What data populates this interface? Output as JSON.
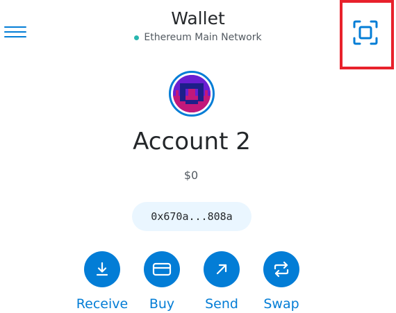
{
  "header": {
    "title": "Wallet",
    "network": "Ethereum Main Network",
    "network_status_color": "#29b6af",
    "menu_icon": "hamburger-menu-icon",
    "scan_icon": "qr-scan-icon",
    "highlight_color": "#e8212b"
  },
  "account": {
    "name": "Account 2",
    "balance": "$0",
    "address": "0x670a...808a",
    "avatar_icon": "identicon-avatar"
  },
  "actions": [
    {
      "label": "Receive",
      "icon": "arrow-down-to-line-icon"
    },
    {
      "label": "Buy",
      "icon": "credit-card-icon"
    },
    {
      "label": "Send",
      "icon": "arrow-up-right-icon"
    },
    {
      "label": "Swap",
      "icon": "swap-arrows-icon"
    }
  ],
  "theme": {
    "accent": "#037dd6",
    "address_background": "#eaf6ff",
    "text": "#24272a",
    "muted_text": "#535a61"
  }
}
